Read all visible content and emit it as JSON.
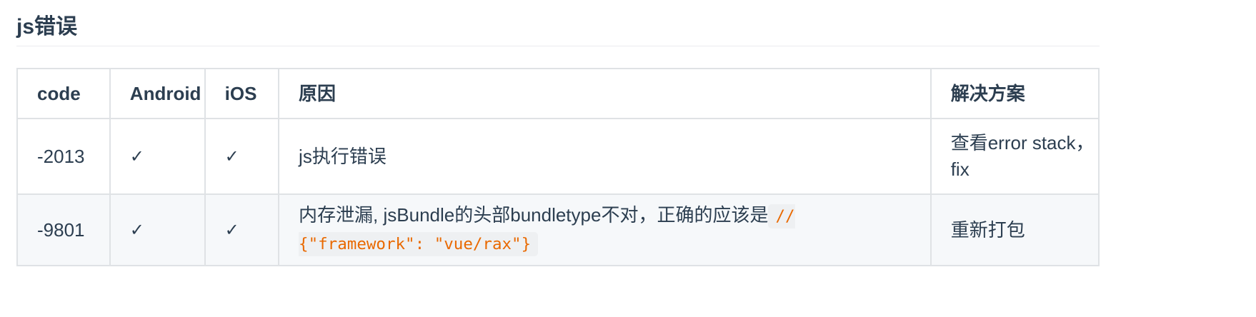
{
  "section": {
    "title": "js错误"
  },
  "table": {
    "headers": {
      "code": "code",
      "android": "Android",
      "ios": "iOS",
      "reason": "原因",
      "solution": "解决方案"
    },
    "rows": [
      {
        "code": "-2013",
        "android": "✓",
        "ios": "✓",
        "reason": "js执行错误",
        "solution": "查看error stack，fix"
      },
      {
        "code": "-9801",
        "android": "✓",
        "ios": "✓",
        "reason_text": "内存泄漏, jsBundle的头部bundletype不对，正确的应该是",
        "reason_code": "// {\"framework\": \"vue/rax\"}",
        "solution": "重新打包"
      }
    ]
  },
  "colors": {
    "text": "#2c3e50",
    "border": "#dfe2e5",
    "stripe": "#f6f8fa",
    "code_text": "#e96900",
    "code_bg": "#eef0f2"
  }
}
